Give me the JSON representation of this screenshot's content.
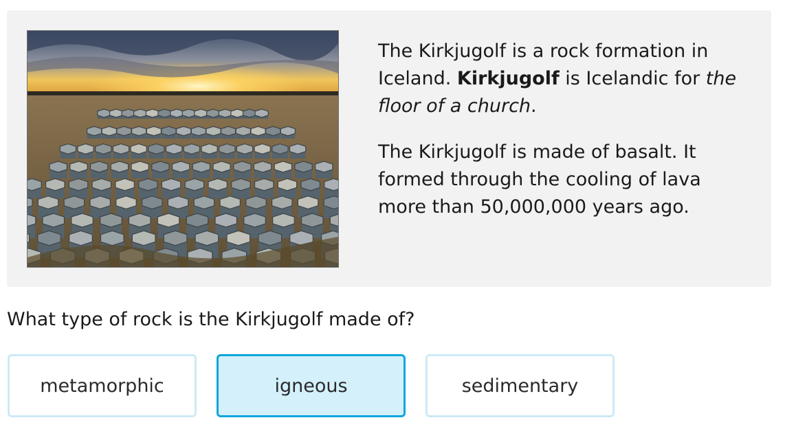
{
  "passage": {
    "p1": {
      "before": "The Kirkjugolf is a rock formation in Iceland. ",
      "bold": "Kirkjugolf",
      "middle": " is Icelandic for ",
      "italic": "the floor of a church",
      "after": "."
    },
    "p2": "The Kirkjugolf is made of basalt. It formed through the cooling of lava more than 50,000,000 years ago."
  },
  "question": "What type of rock is the Kirkjugolf made of?",
  "choices": [
    {
      "label": "metamorphic",
      "selected": false
    },
    {
      "label": "igneous",
      "selected": true
    },
    {
      "label": "sedimentary",
      "selected": false
    }
  ],
  "colors": {
    "selected_border": "#0ea5dc",
    "selected_fill": "#d3f0fb",
    "unselected_border": "#cdeaf6"
  }
}
